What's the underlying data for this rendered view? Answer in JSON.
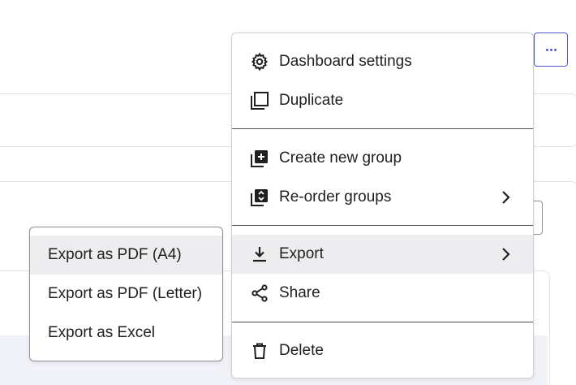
{
  "more_button": {
    "icon": "ellipsis-icon"
  },
  "menu": {
    "items": [
      {
        "label": "Dashboard settings",
        "icon": "gear-icon"
      },
      {
        "label": "Duplicate",
        "icon": "duplicate-icon"
      },
      {
        "label": "Create new group",
        "icon": "add-group-icon"
      },
      {
        "label": "Re-order groups",
        "icon": "reorder-groups-icon",
        "has_submenu": true
      },
      {
        "label": "Export",
        "icon": "download-icon",
        "has_submenu": true,
        "active": true
      },
      {
        "label": "Share",
        "icon": "share-icon"
      },
      {
        "label": "Delete",
        "icon": "trash-icon"
      }
    ]
  },
  "export_submenu": {
    "items": [
      {
        "label": "Export as PDF (A4)",
        "active": true
      },
      {
        "label": "Export as PDF (Letter)"
      },
      {
        "label": "Export as Excel"
      }
    ]
  },
  "colors": {
    "accent": "#4f57d6",
    "hover_bg": "#ededef",
    "divider": "#4a4a4a"
  }
}
